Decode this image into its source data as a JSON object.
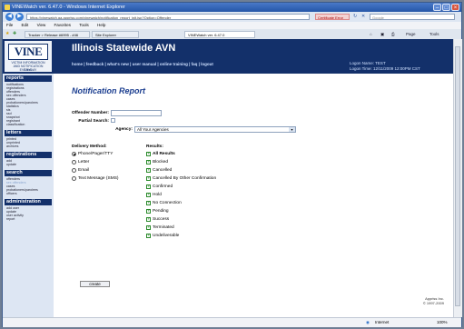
{
  "window": {
    "title": "VINEWatch ver. 6.47.0 - Windows Internet Explorer"
  },
  "browser": {
    "url": "https://vinewatch.ga.appriss.com/vinewatch/notification_report_init.jsp?Option=Offender",
    "cert_error": "Certificate Error",
    "search_placeholder": "Google",
    "menu": [
      "File",
      "Edit",
      "View",
      "Favorites",
      "Tools",
      "Help"
    ],
    "tabs": [
      "Tracker > Release #6995 - #46",
      "Site Explorer",
      "VINEWatch ver. 6.47.0"
    ],
    "tools": {
      "page": "Page",
      "tools": "Tools"
    },
    "status": {
      "zone": "Internet",
      "zoom": "100%"
    }
  },
  "header": {
    "logo": "VINE",
    "logo_sub": "VICTIM INFORMATION AND NOTIFICATION EVERYDAY",
    "lock": "Lock",
    "title": "Illinois Statewide AVN",
    "links": "home | feedback | what's new | user manual | online training | faq | logout",
    "logon_name": "Logon Name: TEST",
    "logon_time": "Logon Time: 12/11/2009 12:00PM CST"
  },
  "sidebar": {
    "reports": {
      "title": "reports",
      "items": [
        "notifications",
        "registrations",
        "offenders",
        "sex offenders",
        "cases",
        "probationers/parolees",
        "statistics",
        "sis",
        "ssd",
        "snapshot",
        "registrant",
        "classification"
      ]
    },
    "letters": {
      "title": "letters",
      "items": [
        "printed",
        "unprinted",
        "archives"
      ]
    },
    "registrations": {
      "title": "registrations",
      "items": [
        "add",
        "update"
      ]
    },
    "search": {
      "title": "search",
      "items": [
        "offenders",
        "sex offenders",
        "cases",
        "probationers/parolees",
        "officers"
      ]
    },
    "administration": {
      "title": "administration",
      "items": [
        "add user",
        "update",
        "user activity",
        "report"
      ]
    }
  },
  "form": {
    "page_title": "Notification Report",
    "offender_number_label": "Offender Number:",
    "partial_search_label": "Partial Search:",
    "agency_label": "Agency:",
    "agency_value": "All Your Agencies",
    "delivery_method_label": "Delivery Method:",
    "delivery_methods": [
      {
        "label": "Phone/Pager/TTY",
        "selected": true
      },
      {
        "label": "Letter",
        "selected": false
      },
      {
        "label": "Email",
        "selected": false
      },
      {
        "label": "Text Message (SMS)",
        "selected": false
      }
    ],
    "results_label": "Results:",
    "results": [
      {
        "label": "All Results",
        "checked": true,
        "bold": true
      },
      {
        "label": "Blocked",
        "checked": true
      },
      {
        "label": "Cancelled",
        "checked": true
      },
      {
        "label": "Cancelled By Other Confirmation",
        "checked": true
      },
      {
        "label": "Confirmed",
        "checked": true
      },
      {
        "label": "Hold",
        "checked": true
      },
      {
        "label": "No Connection",
        "checked": true
      },
      {
        "label": "Pending",
        "checked": true
      },
      {
        "label": "Success",
        "checked": true
      },
      {
        "label": "Terminated",
        "checked": true
      },
      {
        "label": "Undeliverable",
        "checked": true
      }
    ],
    "create_label": "create"
  },
  "footer": {
    "company": "Appriss Inc.",
    "copyright": "© 1997-2009"
  }
}
